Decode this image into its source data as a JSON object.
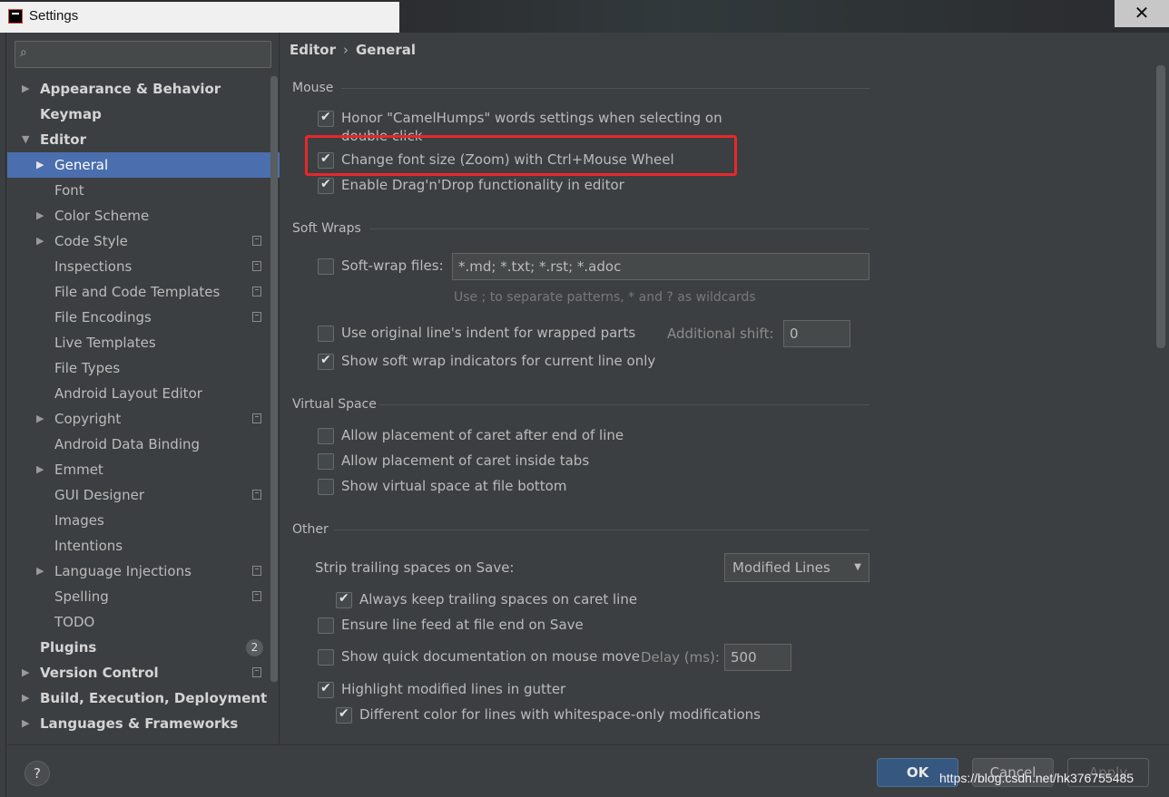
{
  "window": {
    "title": "Settings",
    "close_glyph": "✕"
  },
  "search": {
    "icon": "search-icon",
    "glyph": "⌕",
    "placeholder": ""
  },
  "tree": [
    {
      "label": "Appearance & Behavior",
      "level": 0,
      "bold": true,
      "arrow": "▶",
      "copy": false
    },
    {
      "label": "Keymap",
      "level": 0,
      "bold": true,
      "arrow": "",
      "copy": false
    },
    {
      "label": "Editor",
      "level": 0,
      "bold": true,
      "arrow": "▼",
      "copy": false
    },
    {
      "label": "General",
      "level": 1,
      "bold": false,
      "arrow": "▶",
      "copy": false,
      "selected": true
    },
    {
      "label": "Font",
      "level": 1,
      "bold": false,
      "arrow": "",
      "copy": false
    },
    {
      "label": "Color Scheme",
      "level": 1,
      "bold": false,
      "arrow": "▶",
      "copy": false
    },
    {
      "label": "Code Style",
      "level": 1,
      "bold": false,
      "arrow": "▶",
      "copy": true
    },
    {
      "label": "Inspections",
      "level": 1,
      "bold": false,
      "arrow": "",
      "copy": true
    },
    {
      "label": "File and Code Templates",
      "level": 1,
      "bold": false,
      "arrow": "",
      "copy": true
    },
    {
      "label": "File Encodings",
      "level": 1,
      "bold": false,
      "arrow": "",
      "copy": true
    },
    {
      "label": "Live Templates",
      "level": 1,
      "bold": false,
      "arrow": "",
      "copy": false
    },
    {
      "label": "File Types",
      "level": 1,
      "bold": false,
      "arrow": "",
      "copy": false
    },
    {
      "label": "Android Layout Editor",
      "level": 1,
      "bold": false,
      "arrow": "",
      "copy": false
    },
    {
      "label": "Copyright",
      "level": 1,
      "bold": false,
      "arrow": "▶",
      "copy": true
    },
    {
      "label": "Android Data Binding",
      "level": 1,
      "bold": false,
      "arrow": "",
      "copy": false
    },
    {
      "label": "Emmet",
      "level": 1,
      "bold": false,
      "arrow": "▶",
      "copy": false
    },
    {
      "label": "GUI Designer",
      "level": 1,
      "bold": false,
      "arrow": "",
      "copy": true
    },
    {
      "label": "Images",
      "level": 1,
      "bold": false,
      "arrow": "",
      "copy": false
    },
    {
      "label": "Intentions",
      "level": 1,
      "bold": false,
      "arrow": "",
      "copy": false
    },
    {
      "label": "Language Injections",
      "level": 1,
      "bold": false,
      "arrow": "▶",
      "copy": true
    },
    {
      "label": "Spelling",
      "level": 1,
      "bold": false,
      "arrow": "",
      "copy": true
    },
    {
      "label": "TODO",
      "level": 1,
      "bold": false,
      "arrow": "",
      "copy": false
    },
    {
      "label": "Plugins",
      "level": 0,
      "bold": true,
      "arrow": "",
      "copy": false,
      "badge": "2"
    },
    {
      "label": "Version Control",
      "level": 0,
      "bold": true,
      "arrow": "▶",
      "copy": true
    },
    {
      "label": "Build, Execution, Deployment",
      "level": 0,
      "bold": true,
      "arrow": "▶",
      "copy": false
    },
    {
      "label": "Languages & Frameworks",
      "level": 0,
      "bold": true,
      "arrow": "▶",
      "copy": false
    }
  ],
  "breadcrumb": {
    "parent": "Editor",
    "separator": "›",
    "current": "General"
  },
  "sections": {
    "mouse": {
      "title": "Mouse",
      "honor_camelhumps": {
        "label_line1": "Honor \"CamelHumps\" words settings when selecting on",
        "label_line2": "double click",
        "checked": true
      },
      "zoom": {
        "label": "Change font size (Zoom) with Ctrl+Mouse Wheel",
        "checked": true
      },
      "dragdrop": {
        "label": "Enable Drag'n'Drop functionality in editor",
        "checked": true
      }
    },
    "soft_wraps": {
      "title": "Soft Wraps",
      "soft_wrap_files": {
        "label": "Soft-wrap files:",
        "checked": false,
        "value": "*.md; *.txt; *.rst; *.adoc"
      },
      "hint": "Use ; to separate patterns, * and ? as wildcards",
      "original_indent": {
        "label": "Use original line's indent for wrapped parts",
        "checked": false
      },
      "additional_shift": {
        "label": "Additional shift:",
        "value": "0"
      },
      "indicators": {
        "label": "Show soft wrap indicators for current line only",
        "checked": true
      }
    },
    "virtual_space": {
      "title": "Virtual Space",
      "after_end": {
        "label": "Allow placement of caret after end of line",
        "checked": false
      },
      "inside_tabs": {
        "label": "Allow placement of caret inside tabs",
        "checked": false
      },
      "file_bottom": {
        "label": "Show virtual space at file bottom",
        "checked": false
      }
    },
    "other": {
      "title": "Other",
      "strip_label": "Strip trailing spaces on Save:",
      "strip_value": "Modified Lines",
      "keep_trailing": {
        "label": "Always keep trailing spaces on caret line",
        "checked": true
      },
      "line_feed": {
        "label": "Ensure line feed at file end on Save",
        "checked": false
      },
      "quick_doc": {
        "label": "Show quick documentation on mouse move",
        "checked": false
      },
      "delay": {
        "label": "Delay (ms):",
        "value": "500"
      },
      "highlight_modified": {
        "label": "Highlight modified lines in gutter",
        "checked": true
      },
      "whitespace_color": {
        "label": "Different color for lines with whitespace-only modifications",
        "checked": true
      }
    }
  },
  "buttons": {
    "help": "?",
    "ok": "OK",
    "cancel": "Cancel",
    "apply": "Apply"
  },
  "watermark": "https://blog.csdn.net/hk376755485",
  "colors": {
    "background": "#3c3f41",
    "selection": "#4b6eaf",
    "highlight_box": "#e8272b",
    "ok_button": "#365880"
  }
}
